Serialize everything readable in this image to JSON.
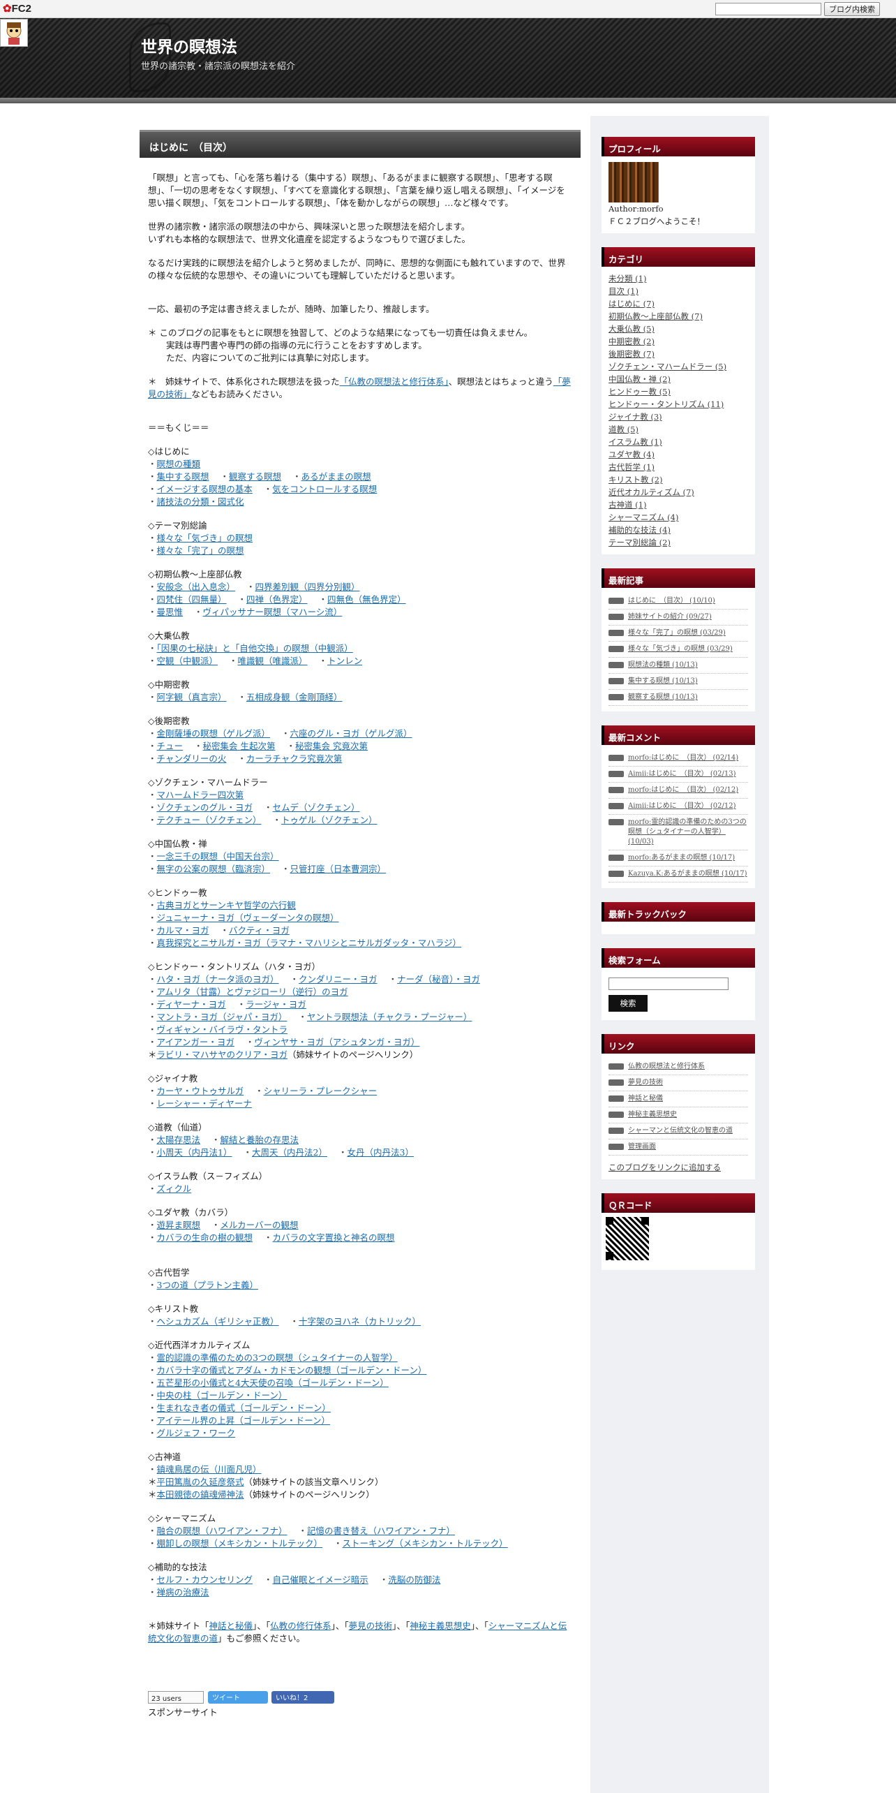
{
  "fc2bar": {
    "logo": "FC2",
    "search_placeholder": "",
    "search_button": "ブログ内検索"
  },
  "header": {
    "title": "世界の瞑想法",
    "subtitle": "世界の諸宗教・諸宗派の瞑想法を紹介"
  },
  "entry": {
    "title": "はじめに　（目次）",
    "intro": [
      "「瞑想」と言っても、「心を落ち着ける（集中する）瞑想」、「あるがままに観察する瞑想」、「思考する瞑想」、「一切の思考をなくす瞑想」、「すべてを意識化する瞑想」、「言葉を繰り返し唱える瞑想」、「イメージを思い描く瞑想」、「気をコントロールする瞑想」、「体を動かしながらの瞑想」…など様々です。",
      "世界の諸宗教・諸宗派の瞑想法の中から、興味深いと思った瞑想法を紹介します。\nいずれも本格的な瞑想法で、世界文化遺産を認定するようなつもりで選びました。",
      "なるだけ実践的に瞑想法を紹介しようと努めましたが、同時に、思想的な側面にも触れていますので、世界の様々な伝統的な思想や、その違いについても理解していただけると思います。",
      "一応、最初の予定は書き終えましたが、随時、加筆したり、推敲します。"
    ],
    "notice1": "＊ このブログの記事をもとに瞑想を独習して、どのような結果になっても一切責任は負えません。",
    "notice1b": "実践は専門書や専門の師の指導の元に行うことをおすすめします。",
    "notice1c": "ただ、内容についてのご批判には真摯に対応します。",
    "notice2a": "＊　姉妹サイトで、体系化された瞑想法を扱った",
    "notice2link": "「仏教の瞑想法と修行体系」",
    "notice2b": "、瞑想法とはちょっと違う",
    "notice2link2": "「夢見の技術」",
    "notice2c": "などもお読みください。",
    "mokuji": "＝＝もくじ＝＝"
  },
  "sections": [
    {
      "h": "◇はじめに",
      "rows": [
        [
          "瞑想の種類"
        ],
        [
          "集中する瞑想",
          "観察する瞑想",
          "あるがままの瞑想"
        ],
        [
          "イメージする瞑想の基本",
          "気をコントロールする瞑想"
        ],
        [
          "諸技法の分類・図式化"
        ]
      ]
    },
    {
      "h": "◇テーマ別総論",
      "rows": [
        [
          "様々な「気づき」の瞑想"
        ],
        [
          "様々な「完了」の瞑想"
        ]
      ]
    },
    {
      "h": "◇初期仏教～上座部仏教",
      "rows": [
        [
          "安般念（出入息念）",
          "四界差別観（四界分別観）"
        ],
        [
          "四梵住（四無量）",
          "四禅（色界定）",
          "四無色（無色界定）"
        ],
        [
          "曼思惟",
          "ヴィパッサナー瞑想（マハーシ流）"
        ]
      ]
    },
    {
      "h": "◇大乗仏教",
      "rows": [
        [
          "「因果の七秘訣」と「自他交換」の瞑想（中観派）"
        ],
        [
          "空観（中観派）",
          "唯識観（唯識派）",
          "トンレン"
        ]
      ]
    },
    {
      "h": "◇中期密教",
      "rows": [
        [
          "阿字観（真言宗）",
          "五相成身観（金剛頂経）"
        ]
      ]
    },
    {
      "h": "◇後期密教",
      "rows": [
        [
          "金剛薩埵の瞑想（ゲルグ派）",
          "六座のグル・ヨガ（ゲルグ派）"
        ],
        [
          "チュー",
          "秘密集会 生起次第",
          "秘密集会 究竟次第"
        ],
        [
          "チャンダリーの火",
          "カーラチャクラ究竟次第"
        ]
      ]
    },
    {
      "h": "◇ゾクチェン・マハームドラー",
      "rows": [
        [
          "マハームドラー四次第"
        ],
        [
          "ゾクチェンのグル・ヨガ",
          "セムデ（ゾクチェン）"
        ],
        [
          "テクチュー（ゾクチェン）",
          "トゥゲル（ゾクチェン）"
        ]
      ]
    },
    {
      "h": "◇中国仏教・禅",
      "rows": [
        [
          "一念三千の瞑想（中国天台宗）"
        ],
        [
          "無字の公案の瞑想（臨済宗）",
          "只管打座（日本曹洞宗）"
        ]
      ]
    },
    {
      "h": "◇ヒンドゥー教",
      "rows": [
        [
          "古典ヨガとサーンキヤ哲学の六行観"
        ],
        [
          "ジュニャーナ・ヨガ（ヴェーダーンタの瞑想）"
        ],
        [
          "カルマ・ヨガ",
          "バクティ・ヨガ"
        ],
        [
          "真我探究とニサルガ・ヨガ（ラマナ・マハリシとニサルガダッタ・マハラジ）"
        ]
      ]
    },
    {
      "h": "◇ヒンドゥー・タントリズム（ハタ・ヨガ）",
      "rows": [
        [
          "ハタ・ヨガ（ナータ派のヨガ）",
          "クンダリニー・ヨガ",
          "ナーダ（秘音）・ヨガ"
        ],
        [
          "アムリタ（甘露）とヴァジローリ（逆行）のヨガ"
        ],
        [
          "ディヤーナ・ヨガ",
          "ラージャ・ヨガ"
        ],
        [
          "マントラ・ヨガ（ジャパ・ヨガ）",
          "ヤントラ瞑想法（チャクラ・プージャー）"
        ],
        [
          "ヴィギャン・バイラヴ・タントラ"
        ],
        [
          "アイアンガー・ヨガ",
          "ヴィンヤサ・ヨガ（アシュタンガ・ヨガ）"
        ]
      ],
      "extra": {
        "star": "＊",
        "link": "ラビリ・マハサヤのクリア・ヨガ",
        "note": "（姉妹サイトのページへリンク）"
      }
    },
    {
      "h": "◇ジャイナ教",
      "rows": [
        [
          "カーヤ・ウトゥサルガ",
          "シャリーラ・プレークシャー"
        ],
        [
          "レーシャー・ディヤーナ"
        ]
      ]
    },
    {
      "h": "◇道教（仙道）",
      "rows": [
        [
          "太陽存思法",
          "解結と養胎の存思法"
        ],
        [
          "小周天（内丹法1）",
          "大周天（内丹法2）",
          "女丹（内丹法3）"
        ]
      ]
    },
    {
      "h": "◇イスラム教（ス－フィズム）",
      "rows": [
        [
          "ズィクル"
        ]
      ]
    },
    {
      "h": "◇ユダヤ教（カバラ）",
      "rows": [
        [
          "遊昇ま瞑想",
          "メルカーバーの観想"
        ],
        [
          "カバラの生命の樹の観想",
          "カバラの文字置換と神名の瞑想"
        ]
      ]
    },
    {
      "h": "◇古代哲学",
      "rows": [
        [
          "3つの道（プラトン主義）"
        ]
      ],
      "pre_gap": true
    },
    {
      "h": "◇キリスト教",
      "rows": [
        [
          "ヘシュカズム（ギリシャ正教）",
          "十字架のヨハネ（カトリック）"
        ]
      ]
    },
    {
      "h": "◇近代西洋オカルティズム",
      "rows": [
        [
          "霊的認識の準備のための3つの瞑想（シュタイナーの人智学）"
        ],
        [
          "カバラ十字の儀式とアダム・カドモンの観想（ゴールデン・ドーン）"
        ],
        [
          "五芒星形の小儀式と4大天使の召喚（ゴールデン・ドーン）"
        ],
        [
          "中央の柱（ゴールデン・ドーン）"
        ],
        [
          "生まれなき者の儀式（ゴールデン・ドーン）"
        ],
        [
          "アイテール界の上昇（ゴールデン・ドーン）"
        ],
        [
          "グルジェフ・ワーク"
        ]
      ]
    },
    {
      "h": "◇古神道",
      "rows": [
        [
          "鎮魂鳥居の伝（川面凡児）"
        ]
      ],
      "extras": [
        {
          "star": "＊",
          "link": "平田篤胤の久延彦祭式",
          "note": "（姉妹サイトの該当文章へリンク）"
        },
        {
          "star": "＊",
          "link": "本田親徳の鎮魂帰神法",
          "note": "（姉妹サイトのページへリンク）"
        }
      ]
    },
    {
      "h": "◇シャーマニズム",
      "rows": [
        [
          "融合の瞑想（ハワイアン・フナ）",
          "記憶の書き替え（ハワイアン・フナ）"
        ],
        [
          "棚卸しの瞑想（メキシカン・トルテック）",
          "ストーキング（メキシカン・トルテック）"
        ]
      ]
    },
    {
      "h": "◇補助的な技法",
      "rows": [
        [
          "セルフ・カウンセリング",
          "自己催眠とイメージ暗示",
          "洗脳の防御法"
        ],
        [
          "禅病の治療法"
        ]
      ]
    }
  ],
  "footer_note": {
    "prefix": "＊姉妹サイト",
    "links": [
      "神話と秘儀",
      "仏教の修行体系",
      "夢見の技術",
      "神秘主義思想史",
      "シャーマニズムと伝統文化の智恵の道"
    ],
    "suffix": "もご参照ください。"
  },
  "share": {
    "hatena": "23 users",
    "tweet": "ツイート",
    "like": "いいね！2"
  },
  "sponsor": "スポンサーサイト",
  "sidebar": {
    "profile": {
      "title": "プロフィール",
      "author": "Author:morfo",
      "welcome": "ＦＣ２ブログへようこそ！"
    },
    "category": {
      "title": "カテゴリ",
      "items": [
        "未分類 (1)",
        "目次 (1)",
        "はじめに (7)",
        "初期仏教～上座部仏教 (7)",
        "大乗仏教 (5)",
        "中期密教 (2)",
        "後期密教 (7)",
        "ゾクチェン・マハームドラー (5)",
        "中国仏教・禅 (2)",
        "ヒンドゥー教 (5)",
        "ヒンドゥー・タントリズム (11)",
        "ジャイナ教 (3)",
        "道教 (5)",
        "イスラム教 (1)",
        "ユダヤ教 (4)",
        "古代哲学 (1)",
        "キリスト教 (2)",
        "近代オカルティズム (7)",
        "古神道 (1)",
        "シャーマニズム (4)",
        "補助的な技法 (4)",
        "テーマ別総論 (2)"
      ]
    },
    "recent": {
      "title": "最新記事",
      "items": [
        "はじめに　（目次） (10/10)",
        "姉妹サイトの紹介 (09/27)",
        "様々な「完了」の瞑想 (03/29)",
        "様々な「気づき」の瞑想 (03/29)",
        "瞑想法の種類 (10/13)",
        "集中する瞑想 (10/13)",
        "観察する瞑想 (10/13)"
      ]
    },
    "comments": {
      "title": "最新コメント",
      "items": [
        "morfo:はじめに　（目次） (02/14)",
        "Aimii:はじめに　（目次） (02/13)",
        "morfo:はじめに　（目次） (02/12)",
        "Aimii:はじめに　（目次） (02/12)",
        "morfo:霊的認識の準備のための3つの瞑想（シュタイナーの人智学） (10/03)",
        "morfo:あるがままの瞑想 (10/17)",
        "Kazuya.K:あるがままの瞑想 (10/17)"
      ]
    },
    "trackback": {
      "title": "最新トラックバック"
    },
    "search": {
      "title": "検索フォーム",
      "button": "検索"
    },
    "links": {
      "title": "リンク",
      "items": [
        "仏教の瞑想法と修行体系",
        "夢見の技術",
        "神話と秘儀",
        "神秘主義思想史",
        "シャーマンと伝統文化の智恵の道",
        "管理画面"
      ],
      "add": "このブログをリンクに追加する"
    },
    "qr": {
      "title": "ＱＲコード"
    }
  }
}
